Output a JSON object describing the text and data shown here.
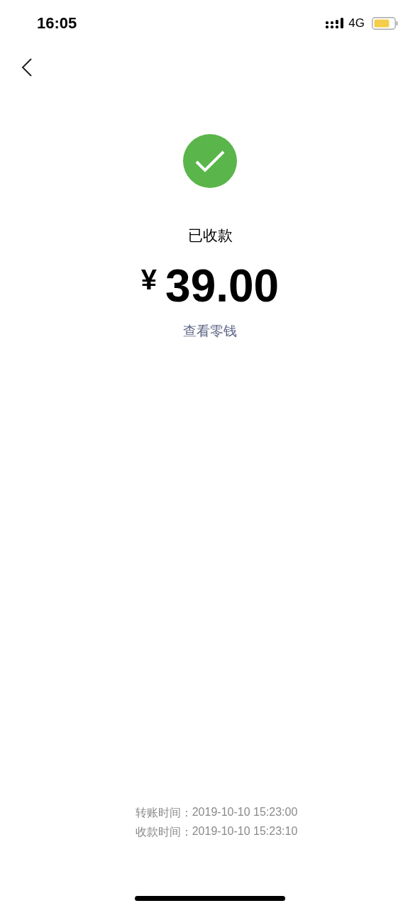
{
  "status_bar": {
    "time": "16:05",
    "network": "4G"
  },
  "status": "已收款",
  "amount": {
    "currency": "¥",
    "value": "39.00"
  },
  "link": "查看零钱",
  "details": [
    {
      "label": "转账时间：",
      "value": "2019-10-10 15:23:00"
    },
    {
      "label": "收款时间：",
      "value": "2019-10-10 15:23:10"
    }
  ]
}
